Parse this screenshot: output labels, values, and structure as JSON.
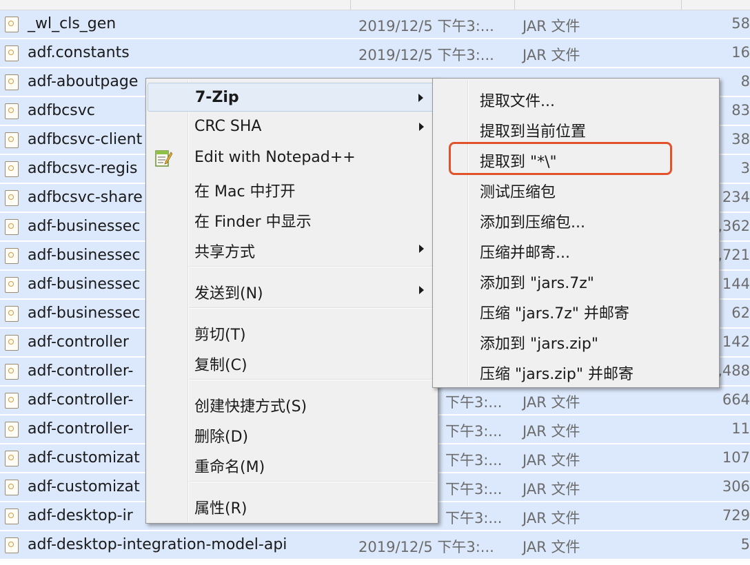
{
  "file_list": {
    "rows": [
      {
        "name": "_wl_cls_gen",
        "date": "2019/12/5 下午3:...",
        "type": "JAR 文件",
        "size": "58"
      },
      {
        "name": "adf.constants",
        "date": "2019/12/5 下午3:...",
        "type": "JAR 文件",
        "size": "16"
      },
      {
        "name": "adf-aboutpage",
        "date": "",
        "type": "",
        "size": "8"
      },
      {
        "name": "adfbcsvc",
        "date": "",
        "type": "",
        "size": "83"
      },
      {
        "name": "adfbcsvc-client",
        "date": "",
        "type": "",
        "size": "38"
      },
      {
        "name": "adfbcsvc-regis",
        "date": "",
        "type": "",
        "size": "3"
      },
      {
        "name": "adfbcsvc-share",
        "date": "",
        "type": "",
        "size": "234"
      },
      {
        "name": "adf-businessec",
        "date": "",
        "type": "",
        "size": ",362"
      },
      {
        "name": "adf-businessec",
        "date": "",
        "type": "",
        "size": ",721"
      },
      {
        "name": "adf-businessec",
        "date": "",
        "type": "",
        "size": "144"
      },
      {
        "name": "adf-businessec",
        "date": "",
        "type": "",
        "size": "62"
      },
      {
        "name": "adf-controller",
        "date": "",
        "type": "",
        "size": "142"
      },
      {
        "name": "adf-controller-",
        "date": "",
        "type": "",
        "size": ",488"
      },
      {
        "name": "adf-controller-",
        "date": "下午3:...",
        "type": "JAR 文件",
        "size": "664"
      },
      {
        "name": "adf-controller-",
        "date": "下午3:...",
        "type": "JAR 文件",
        "size": "11"
      },
      {
        "name": "adf-customizat",
        "date": "下午3:...",
        "type": "JAR 文件",
        "size": "107"
      },
      {
        "name": "adf-customizat",
        "date": "下午3:...",
        "type": "JAR 文件",
        "size": "306"
      },
      {
        "name": "adf-desktop-ir",
        "date": "下午3:...",
        "type": "JAR 文件",
        "size": "729"
      },
      {
        "name": "adf-desktop-integration-model-api",
        "date": "2019/12/5 下午3:...",
        "type": "JAR 文件",
        "size": "5"
      }
    ]
  },
  "context_menu": {
    "items": [
      {
        "label": "7-Zip",
        "bold": true,
        "submenu": true,
        "highlighted": true
      },
      {
        "label": "CRC SHA",
        "submenu": true
      },
      {
        "label": "Edit with Notepad++",
        "icon": "notepad-plus-plus-icon"
      },
      {
        "label": "在 Mac 中打开"
      },
      {
        "label": "在 Finder 中显示"
      },
      {
        "label": "共享方式",
        "submenu": true
      },
      {
        "label": "发送到(N)",
        "submenu": true
      },
      {
        "label": "剪切(T)"
      },
      {
        "label": "复制(C)"
      },
      {
        "label": "创建快捷方式(S)"
      },
      {
        "label": "删除(D)"
      },
      {
        "label": "重命名(M)"
      },
      {
        "label": "属性(R)"
      }
    ]
  },
  "zip_submenu": {
    "items": [
      {
        "label": "提取文件..."
      },
      {
        "label": "提取到当前位置"
      },
      {
        "label": "提取到 \"*\\\"",
        "annotated": true
      },
      {
        "label": "测试压缩包"
      },
      {
        "label": "添加到压缩包..."
      },
      {
        "label": "压缩并邮寄..."
      },
      {
        "label": "添加到 \"jars.7z\""
      },
      {
        "label": "压缩 \"jars.7z\" 并邮寄"
      },
      {
        "label": "添加到 \"jars.zip\""
      },
      {
        "label": "压缩 \"jars.zip\" 并邮寄"
      }
    ]
  },
  "colors": {
    "row_selected": "#dce8fb",
    "menu_bg": "#f0f0f0",
    "annotation": "#e2522b"
  }
}
